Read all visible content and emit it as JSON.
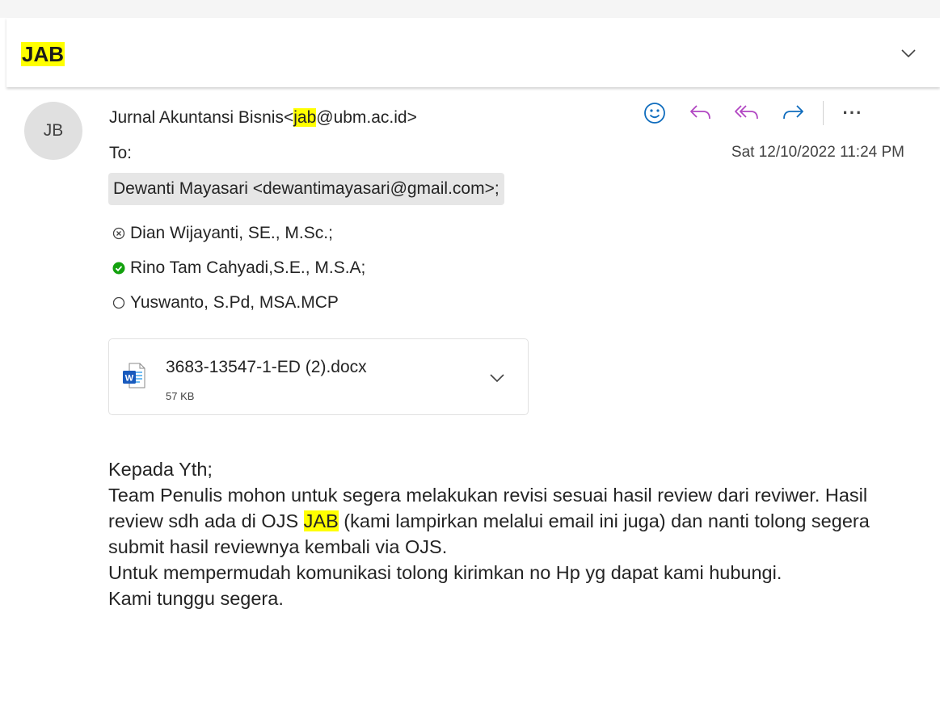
{
  "subject": "JAB",
  "sender": {
    "avatar_initials": "JB",
    "name": "Jurnal Akuntansi Bisnis",
    "email_highlight": "jab",
    "email_rest": "@ubm.ac.id>",
    "email_open": "<"
  },
  "to_label": "To:",
  "date": "Sat 12/10/2022 11:24 PM",
  "recipients": [
    {
      "name": "Dewanti Mayasari <dewantimayasari@gmail.com>;",
      "status": "none"
    },
    {
      "name": "Dian Wijayanti, SE., M.Sc.;",
      "status": "declined"
    },
    {
      "name": "Rino Tam Cahyadi,S.E., M.S.A;",
      "status": "accepted"
    },
    {
      "name": "Yuswanto, S.Pd, MSA.MCP",
      "status": "pending"
    }
  ],
  "attachment": {
    "filename": "3683-13547-1-ED (2).docx",
    "size": "57 KB",
    "icon": "word-doc-icon"
  },
  "actions": [
    "emoji-icon",
    "reply-icon",
    "reply-all-icon",
    "forward-icon",
    "more-icon"
  ],
  "more_label": "···",
  "body": {
    "line1": "Kepada Yth;",
    "para2_before": "Team Penulis mohon untuk segera melakukan revisi sesuai hasil review dari reviwer. Hasil review sdh ada di OJS ",
    "para2_highlight": "JAB",
    "para2_after": " (kami lampirkan melalui email ini juga) dan nanti tolong segera submit hasil reviewnya kembali via OJS.",
    "para3": "Untuk mempermudah komunikasi tolong kirimkan no Hp yg dapat kami hubungi.",
    "para4": "Kami tunggu segera."
  },
  "colors": {
    "highlight": "#ffff00",
    "accent": "#0f6cbd",
    "reply_all": "#b146c2",
    "accepted": "#13a10e"
  }
}
